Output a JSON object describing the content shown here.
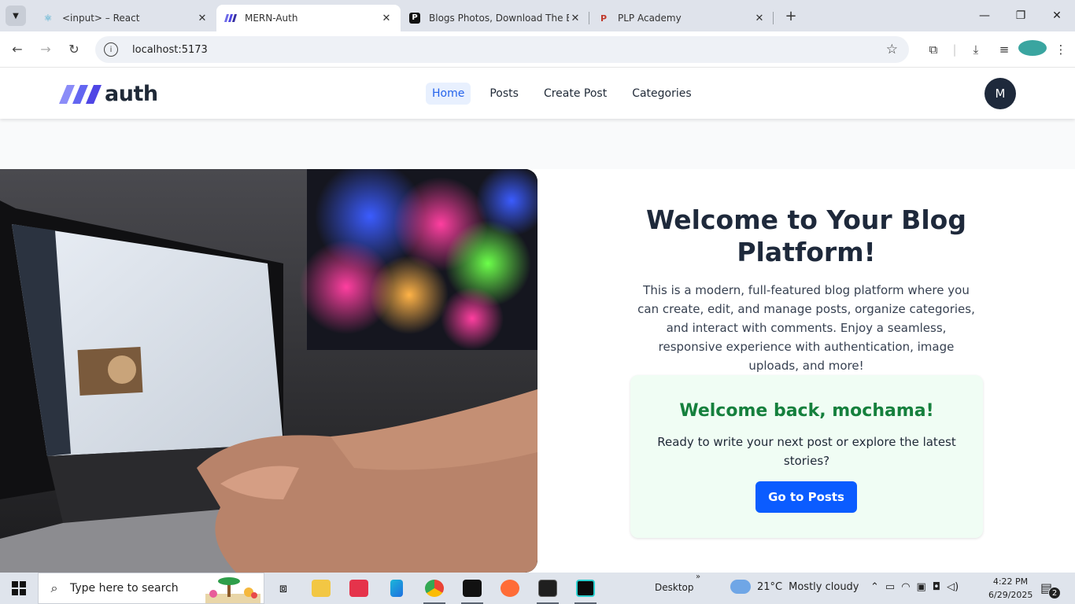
{
  "browser": {
    "tabs": [
      {
        "title": "<input> – React",
        "active": false
      },
      {
        "title": "MERN-Auth",
        "active": true
      },
      {
        "title": "Blogs Photos, Download The BE",
        "active": false
      },
      {
        "title": "PLP Academy",
        "active": false
      }
    ],
    "url": "localhost:5173"
  },
  "app": {
    "logo_text": "auth",
    "nav": [
      "Home",
      "Posts",
      "Create Post",
      "Categories"
    ],
    "active_nav": "Home",
    "avatar_initial": "M"
  },
  "hero": {
    "title": "Welcome to Your Blog Platform!",
    "description": "This is a modern, full-featured blog platform where you can create, edit, and manage posts, organize categories, and interact with comments. Enjoy a seamless, responsive experience with authentication, image uploads, and more!",
    "card": {
      "heading": "Welcome back, mochama!",
      "text": "Ready to write your next post or explore the latest stories?",
      "button": "Go to Posts"
    }
  },
  "taskbar": {
    "search_placeholder": "Type here to search",
    "desktop_label": "Desktop",
    "temperature": "21°C",
    "weather": "Mostly cloudy",
    "time": "4:22 PM",
    "date": "6/29/2025",
    "notification_count": "2"
  },
  "colors": {
    "primary": "#0b5cff",
    "nav_active_bg": "#e8f0fe",
    "card_bg": "#f0fdf4",
    "card_heading": "#15803d",
    "avatar_bg": "#1e293b"
  }
}
